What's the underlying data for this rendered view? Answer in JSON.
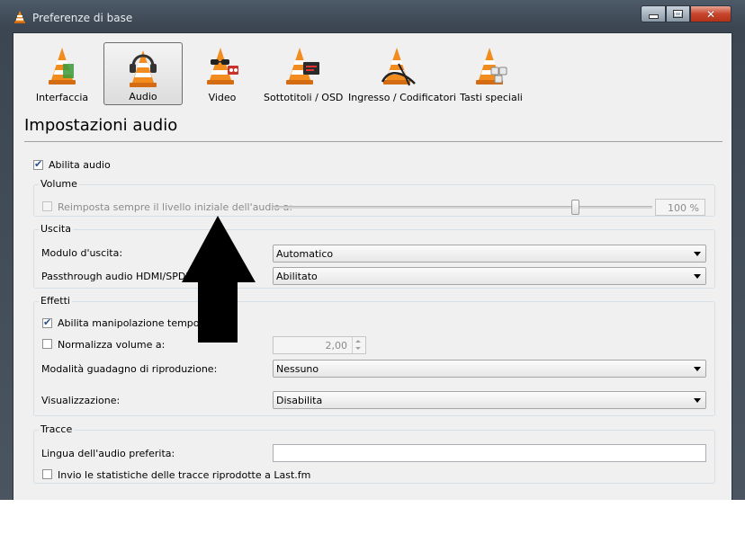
{
  "window": {
    "title": "Preferenze di base"
  },
  "categories": [
    {
      "label": "Interfaccia",
      "icon": "vlc-cone-interface-icon",
      "selected": false
    },
    {
      "label": "Audio",
      "icon": "vlc-cone-headphones-icon",
      "selected": true
    },
    {
      "label": "Video",
      "icon": "vlc-cone-glasses-icon",
      "selected": false
    },
    {
      "label": "Sottotitoli / OSD",
      "icon": "vlc-cone-subtitles-icon",
      "selected": false
    },
    {
      "label": "Ingresso / Codificatori",
      "icon": "vlc-cone-cable-icon",
      "selected": false
    },
    {
      "label": "Tasti speciali",
      "icon": "vlc-cone-keys-icon",
      "selected": false
    }
  ],
  "page": {
    "title": "Impostazioni audio",
    "enable_audio": {
      "label": "Abilita audio",
      "checked": true
    }
  },
  "volume": {
    "title": "Volume",
    "reset_label": "Reimposta sempre il livello iniziale dell'audio a:",
    "reset_checked": false,
    "level_value": "100 %",
    "level": 1.0
  },
  "output": {
    "title": "Uscita",
    "module_label": "Modulo d'uscita:",
    "module_value": "Automatico",
    "passthrough_label": "Passthrough audio HDMI/SPDIF",
    "passthrough_value": "Abilitato"
  },
  "effects": {
    "title": "Effetti",
    "time_stretch_label": "Abilita manipolazione temporale d",
    "time_stretch_checked": true,
    "normalize_label": "Normalizza volume a:",
    "normalize_checked": false,
    "normalize_value": "2,00",
    "replay_gain_label": "Modalità guadagno di riproduzione:",
    "replay_gain_value": "Nessuno",
    "visualization_label": "Visualizzazione:",
    "visualization_value": "Disabilita"
  },
  "tracks": {
    "title": "Tracce",
    "preferred_lang_label": "Lingua dell'audio preferita:",
    "preferred_lang_value": "",
    "lastfm_label": "Invio le statistiche delle tracce riprodotte a Last.fm",
    "lastfm_checked": false
  },
  "colors": {
    "cone_orange": "#f28c1e",
    "frame": "#3e4955",
    "panel": "#f0f0f0",
    "annotation_arrow": "#000000"
  }
}
